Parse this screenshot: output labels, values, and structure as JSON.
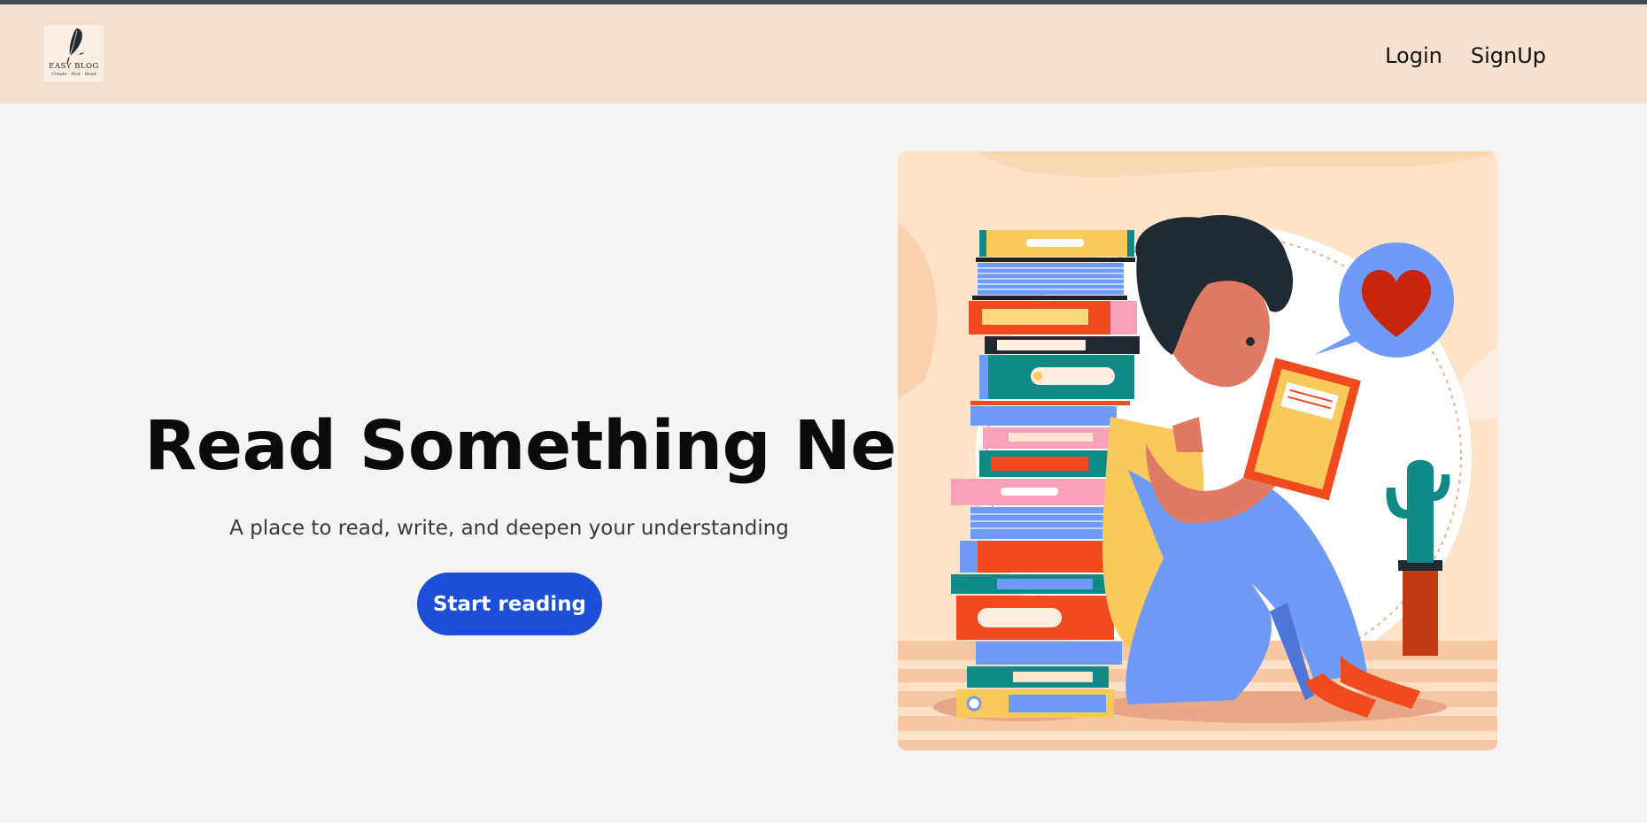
{
  "navbar": {
    "logo": {
      "title": "EASY BLOG",
      "subtitle": "Create · Post · Read",
      "icon": "quill-feather-icon"
    },
    "links": {
      "login": "Login",
      "signup": "SignUp"
    }
  },
  "hero": {
    "title": "Read Something New",
    "subtitle": "A place to read, write, and deepen your understanding",
    "cta_label": "Start reading"
  },
  "illustration": {
    "subject": "person-reading-book-icon",
    "elements": [
      "book-stack-icon",
      "heart-speech-bubble-icon",
      "cactus-plant-icon"
    ]
  },
  "colors": {
    "navbar_bg": "#f5e1cf",
    "page_bg": "#f4f4f4",
    "accent": "#1d4ed8",
    "topbar": "#3f4a54"
  }
}
